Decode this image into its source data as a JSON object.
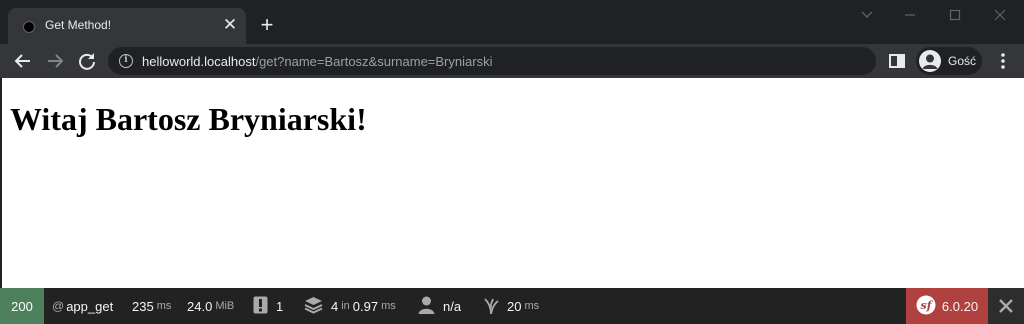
{
  "browser": {
    "tab": {
      "title": "Get Method!"
    },
    "address_bar": {
      "host": "helloworld.localhost",
      "path": "/get?name=Bartosz&surname=Bryniarski"
    },
    "profile": {
      "label": "Gość"
    },
    "colors": {
      "frame": "#202124",
      "toolbar": "#35363a",
      "text": "#e8eaed"
    }
  },
  "page": {
    "heading": "Witaj Bartosz Bryniarski!"
  },
  "debug_toolbar": {
    "status_code": "200",
    "route_prefix": "@",
    "route": "app_get",
    "time_value": "235",
    "time_unit": "ms",
    "memory_value": "24.0",
    "memory_unit": "MiB",
    "logs_count": "1",
    "cache_count": "4",
    "cache_in_label": "in",
    "cache_time": "0.97",
    "cache_time_unit": "ms",
    "user": "n/a",
    "twig_time": "20",
    "twig_unit": "ms",
    "symfony_version": "6.0.20",
    "colors": {
      "status_ok": "#4f805d",
      "version_badge": "#b0413e",
      "bar": "#222222"
    }
  }
}
